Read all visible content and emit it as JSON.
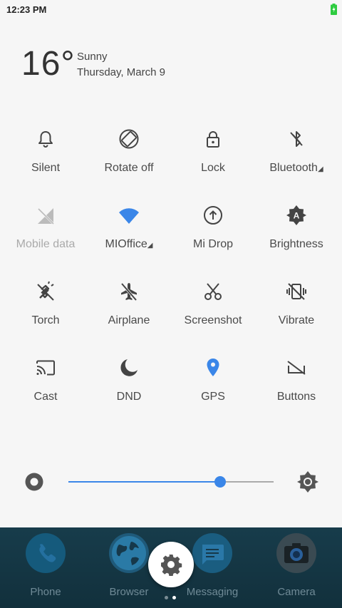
{
  "status": {
    "time": "12:23 PM"
  },
  "weather": {
    "temperature": "16°",
    "condition": "Sunny",
    "date": "Thursday, March 9"
  },
  "toggles": [
    {
      "label": "Silent",
      "icon": "bell-icon"
    },
    {
      "label": "Rotate off",
      "icon": "rotate-icon"
    },
    {
      "label": "Lock",
      "icon": "lock-icon"
    },
    {
      "label": "Bluetooth",
      "icon": "bluetooth-off-icon",
      "expandable": true
    },
    {
      "label": "Mobile data",
      "icon": "mobile-data-off-icon",
      "disabled": true
    },
    {
      "label": "MIOffice",
      "icon": "wifi-icon",
      "expandable": true,
      "active": true
    },
    {
      "label": "Mi Drop",
      "icon": "upload-icon"
    },
    {
      "label": "Brightness",
      "icon": "auto-brightness-icon"
    },
    {
      "label": "Torch",
      "icon": "torch-icon"
    },
    {
      "label": "Airplane",
      "icon": "airplane-icon"
    },
    {
      "label": "Screenshot",
      "icon": "scissors-icon"
    },
    {
      "label": "Vibrate",
      "icon": "vibrate-off-icon"
    },
    {
      "label": "Cast",
      "icon": "cast-icon"
    },
    {
      "label": "DND",
      "icon": "moon-icon"
    },
    {
      "label": "GPS",
      "icon": "location-pin-icon",
      "active": true
    },
    {
      "label": "Buttons",
      "icon": "buttons-off-icon"
    }
  ],
  "brightness": {
    "level": 0.74
  },
  "dock": {
    "apps": [
      {
        "label": "Phone",
        "icon": "phone-icon"
      },
      {
        "label": "Browser",
        "icon": "globe-icon"
      },
      {
        "label": "Messaging",
        "icon": "message-icon"
      },
      {
        "label": "Camera",
        "icon": "camera-icon"
      }
    ]
  },
  "colors": {
    "accent": "#3a86e8",
    "battery": "#2ecc40"
  }
}
